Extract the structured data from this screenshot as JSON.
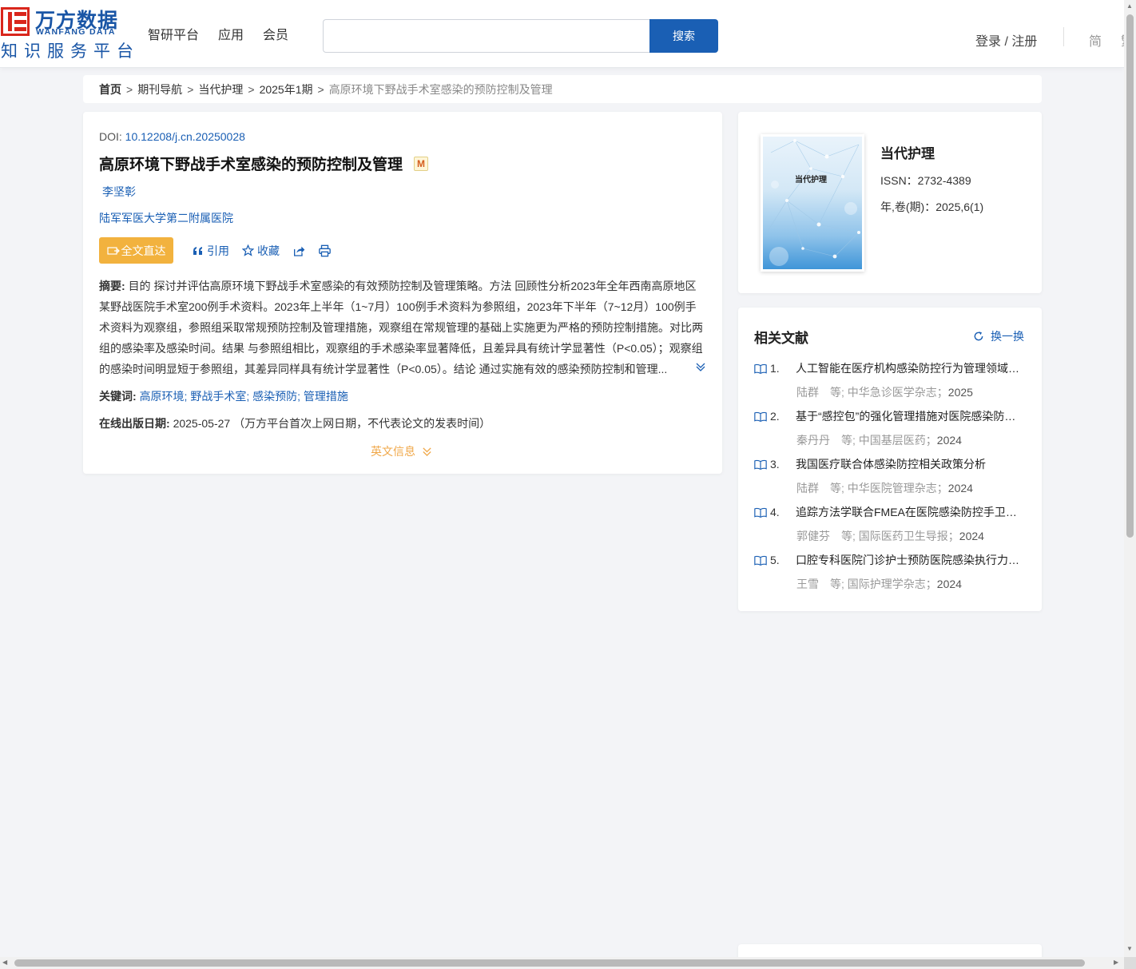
{
  "header": {
    "logo_cn": "万方数据",
    "logo_en": "WANFANG DATA",
    "logo_sub": "知识服务平台",
    "nav": [
      "智研平台",
      "应用",
      "会员"
    ],
    "search": {
      "placeholder": "",
      "button": "搜索"
    },
    "login": "登录 / 注册",
    "lang": "简",
    "lang_alt": "繁"
  },
  "breadcrumb": {
    "items": [
      "首页",
      "期刊导航",
      "当代护理",
      "2025年1期"
    ],
    "current": "高原环境下野战手术室感染的预防控制及管理",
    "separator": ">"
  },
  "article": {
    "doi_label": "DOI:",
    "doi": "10.12208/j.cn.20250028",
    "title": "高原环境下野战手术室感染的预防控制及管理",
    "badge": "M",
    "author": "李坚彰",
    "org": "陆军军医大学第二附属医院",
    "actions": {
      "fulltext": "全文直达",
      "cite": "引用",
      "favorite": "收藏"
    },
    "abstract_label": "摘要:",
    "abstract": "目的 探讨并评估高原环境下野战手术室感染的有效预防控制及管理策略。方法 回顾性分析2023年全年西南高原地区某野战医院手术室200例手术资料。2023年上半年（1~7月）100例手术资料为参照组，2023年下半年（7~12月）100例手术资料为观察组，参照组采取常规预防控制及管理措施，观察组在常规管理的基础上实施更为严格的预防控制措施。对比两组的感染率及感染时间。结果 与参照组相比，观察组的手术感染率显著降低，且差异具有统计学显著性（P<0.05）；观察组的感染时间明显短于参照组，其差异同样具有统计学显著性（P<0.05）。结论 通过实施有效的感染预防控制和管理...",
    "keywords_label": "关键词:",
    "keywords": [
      "高原环境;",
      "野战手术室;",
      "感染预防;",
      "管理措施"
    ],
    "pubdate_label": "在线出版日期:",
    "pubdate": "2025-05-27",
    "pubdate_note": "（万方平台首次上网日期，不代表论文的发表时间）",
    "en_info": "英文信息"
  },
  "journal": {
    "cover_title": "当代护理",
    "name": "当代护理",
    "issn": "ISSN：2732-4389",
    "volume": "年,卷(期)：2025,6(1)"
  },
  "related": {
    "heading": "相关文献",
    "refresh": "换一换",
    "items": [
      {
        "num": "1.",
        "title": "人工智能在医疗机构感染防控行为管理领域的应用",
        "authors": "陆群　等;",
        "journal": "中华急诊医学杂志；",
        "year": "2025"
      },
      {
        "num": "2.",
        "title": "基于“感控包”的强化管理措施对医院感染防控的效果",
        "authors": "秦丹丹　等;",
        "journal": "中国基层医药；",
        "year": "2024"
      },
      {
        "num": "3.",
        "title": "我国医疗联合体感染防控相关政策分析",
        "authors": "陆群　等;",
        "journal": "中华医院管理杂志；",
        "year": "2024"
      },
      {
        "num": "4.",
        "title": "追踪方法学联合FMEA在医院感染防控手卫生管理中的应用",
        "authors": "郭健芬　等;",
        "journal": "国际医药卫生导报；",
        "year": "2024"
      },
      {
        "num": "5.",
        "title": "口腔专科医院门诊护士预防医院感染执行力的调查分析",
        "authors": "王雪　等;",
        "journal": "国际护理学杂志；",
        "year": "2024"
      }
    ]
  }
}
